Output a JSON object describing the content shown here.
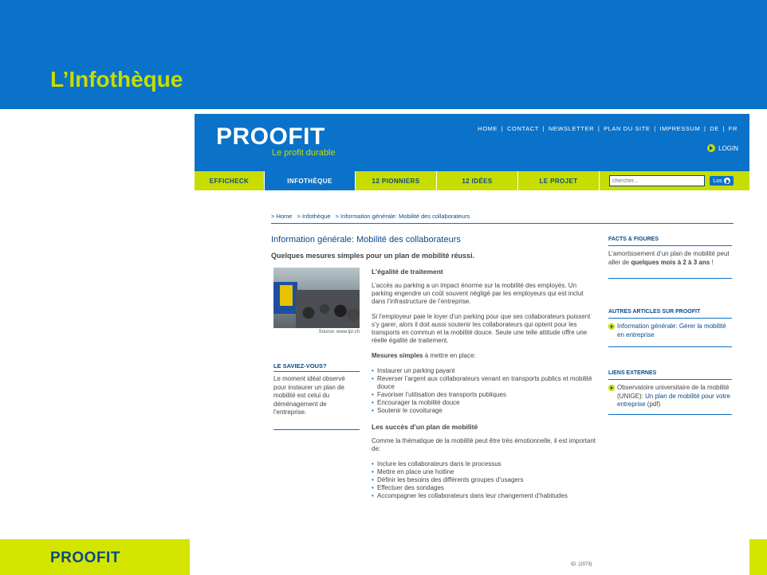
{
  "slide": {
    "title": "L’Infothèque",
    "footer_brand": "PROOFIT"
  },
  "site": {
    "logo_text": "PROOFIT",
    "logo_tagline": "Le profit durable",
    "top_nav": [
      "HOME",
      "|",
      "CONTACT",
      "|",
      "NEWSLETTER",
      "|",
      "PLAN DU SITE",
      "|",
      "IMPRESSUM",
      "|",
      "DE",
      "|",
      "FR"
    ],
    "login_label": "LOGIN",
    "main_nav": [
      {
        "label": "EFFICHECK",
        "active": false
      },
      {
        "label": "INFOTHÈQUE",
        "active": true
      },
      {
        "label": "12 PIONNIERS",
        "active": false
      },
      {
        "label": "12 IDÉES",
        "active": false
      },
      {
        "label": "LE PROJET",
        "active": false
      }
    ],
    "search": {
      "placeholder": "chercher...",
      "button_label": "Los"
    },
    "breadcrumb": [
      "> Home",
      "> Infothèque",
      "> Information générale: Mobilité des collaborateurs"
    ]
  },
  "article": {
    "title": "Information générale: Mobilité des collaborateurs",
    "subtitle": "Quelques mesures simples pour un plan de mobilité réussi.",
    "photo_caption": "Source: www.tpr.ch",
    "h1": "L’égalité de traitement",
    "p1": "L’accès au parking a un impact énorme sur la mobilité des employés. Un parking engendre un coût souvent négligé par les employeurs qui est inclut dans l’infrastructure de l’entreprise.",
    "p2": "Si l’employeur paie le loyer d’un parking pour que ses collaborateurs puissent s’y garer, alors il doit aussi soutenir les collaborateurs qui optent pour les transports en commun et la mobilité douce. Seule une telle attitude offre une réelle égalité de traitement.",
    "measures_lead": "Mesures simples",
    "measures_rest": " à mettre en place:",
    "measures": [
      "Instaurer un parking payant",
      "Reverser l’argent aux collaborateurs venant en transports publics et mobilité douce",
      "Favoriser l’utilisation des transports publiques",
      "Encourager la mobilité douce",
      "Soutenir le covoiturage"
    ],
    "h2": "Les succès d’un plan de mobilité",
    "p3": "Comme la thématique de la mobilité peut être très émotionnelle, il est important de:",
    "successes": [
      "Inclure les collaborateurs dans le processus",
      "Mettre en place une hotline",
      "Définir les besoins des différents groupes d’usagers",
      "Effectuer des sondages",
      "Accompagner les collaborateurs dans leur changement d’habitudes"
    ],
    "page_id": "ID: (2073)"
  },
  "left_box": {
    "title": "LE SAVIEZ-VOUS?",
    "text": "Le moment idéal observé pour instaurer un plan de mobilité est celui du déménagement de l’entreprise."
  },
  "right_col": {
    "facts_title": "FACTS & FIGURES",
    "facts_text_a": "L’amortissement d’un plan de mobilité peut aller de ",
    "facts_text_b": "quelques mois à 2 à 3 ans",
    "facts_text_c": " !",
    "articles_title": "AUTRES ARTICLES SUR PROOFIT",
    "articles_link": "Information générale: Gérer la mobilité en entreprise",
    "links_title": "LIENS EXTERNES",
    "links_plain": "Observatoire universitaire de la mobilité (UNIGE): ",
    "links_link": "Un plan de mobilité pour votre entreprise",
    "links_suffix": " (pdf)"
  }
}
